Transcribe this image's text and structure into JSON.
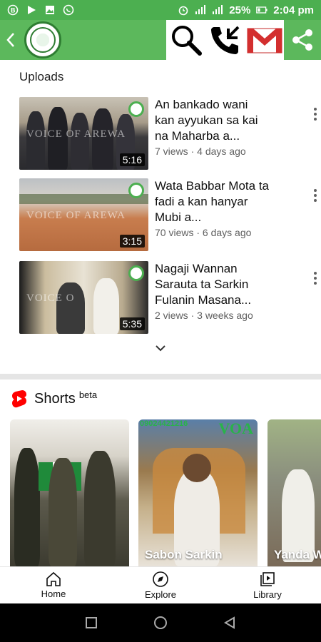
{
  "status_bar": {
    "battery": "25%",
    "time": "2:04 pm",
    "icons": [
      "whatsapp-business-icon",
      "play-icon",
      "image-icon",
      "whatsapp-icon",
      "alarm-icon",
      "signal-1-icon",
      "signal-2-icon",
      "battery-icon"
    ]
  },
  "app_bar": {
    "actions": [
      "search-icon",
      "phone-call-icon",
      "gmail-icon",
      "share-icon"
    ],
    "colors": {
      "bar": "#5cb85c",
      "status": "#4caf50"
    }
  },
  "uploads": {
    "title": "Uploads",
    "videos": [
      {
        "title": "An bankado wani kan ayyukan sa kai na Maharba a...",
        "views": "7 views",
        "age": "4 days ago",
        "duration": "5:16",
        "watermark": "VOICE OF AREWA"
      },
      {
        "title": "Wata Babbar Mota ta fadi a kan hanyar Mubi a...",
        "views": "70 views",
        "age": "6 days ago",
        "duration": "3:15",
        "watermark": "VOICE OF AREWA"
      },
      {
        "title": "Nagaji Wannan Sarauta ta Sarkin Fulanin Masana...",
        "views": "2 views",
        "age": "3 weeks ago",
        "duration": "5:35",
        "watermark": "VOICE O"
      }
    ]
  },
  "shorts": {
    "title": "Shorts",
    "beta": "beta",
    "items": [
      {
        "caption": ""
      },
      {
        "caption": "Sabon Sarkin",
        "top_text": "09024421216",
        "big_text": "VOA"
      },
      {
        "caption": "Yanda W"
      }
    ]
  },
  "bottom_nav": {
    "home": "Home",
    "explore": "Explore",
    "library": "Library"
  }
}
